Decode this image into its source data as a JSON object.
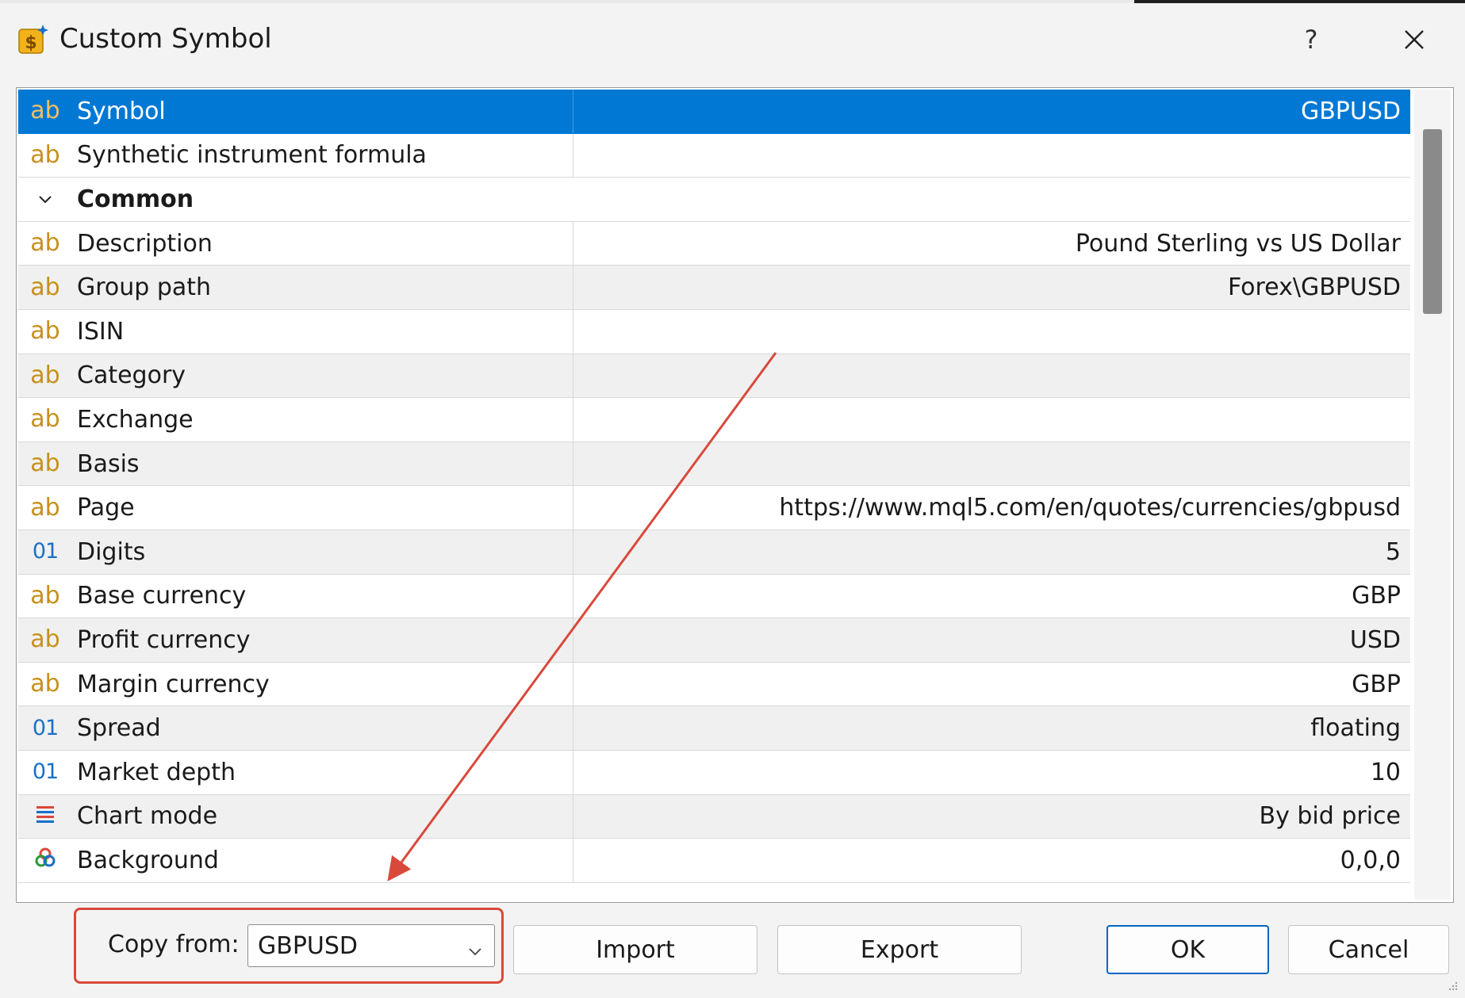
{
  "window": {
    "title": "Custom Symbol",
    "help_label": "?",
    "icons": {
      "app": "dollar-sparkle-icon",
      "close": "close-icon"
    }
  },
  "properties": [
    {
      "kind": "item",
      "type": "ab",
      "name": "Symbol",
      "value": "GBPUSD",
      "selected": true
    },
    {
      "kind": "item",
      "type": "ab",
      "name": "Synthetic instrument formula",
      "value": ""
    },
    {
      "kind": "group",
      "name": "Common"
    },
    {
      "kind": "item",
      "type": "ab",
      "name": "Description",
      "value": "Pound Sterling vs US Dollar"
    },
    {
      "kind": "item",
      "type": "ab",
      "name": "Group path",
      "value": "Forex\\GBPUSD"
    },
    {
      "kind": "item",
      "type": "ab",
      "name": "ISIN",
      "value": ""
    },
    {
      "kind": "item",
      "type": "ab",
      "name": "Category",
      "value": ""
    },
    {
      "kind": "item",
      "type": "ab",
      "name": "Exchange",
      "value": ""
    },
    {
      "kind": "item",
      "type": "ab",
      "name": "Basis",
      "value": ""
    },
    {
      "kind": "item",
      "type": "ab",
      "name": "Page",
      "value": "https://www.mql5.com/en/quotes/currencies/gbpusd"
    },
    {
      "kind": "item",
      "type": "01",
      "name": "Digits",
      "value": "5"
    },
    {
      "kind": "item",
      "type": "ab",
      "name": "Base currency",
      "value": "GBP"
    },
    {
      "kind": "item",
      "type": "ab",
      "name": "Profit currency",
      "value": "USD"
    },
    {
      "kind": "item",
      "type": "ab",
      "name": "Margin currency",
      "value": "GBP"
    },
    {
      "kind": "item",
      "type": "01",
      "name": "Spread",
      "value": "floating"
    },
    {
      "kind": "item",
      "type": "01",
      "name": "Market depth",
      "value": "10"
    },
    {
      "kind": "item",
      "type": "list",
      "name": "Chart mode",
      "value": "By bid price"
    },
    {
      "kind": "item",
      "type": "color",
      "name": "Background",
      "value": "0,0,0"
    }
  ],
  "footer": {
    "copy_from_label": "Copy from:",
    "copy_from_value": "GBPUSD",
    "import_label": "Import",
    "export_label": "Export",
    "ok_label": "OK",
    "cancel_label": "Cancel"
  },
  "colors": {
    "selection": "#0078d4",
    "annotation": "#d9493b",
    "text_icon": "#c8901a",
    "numeric_icon": "#1a70c8"
  }
}
